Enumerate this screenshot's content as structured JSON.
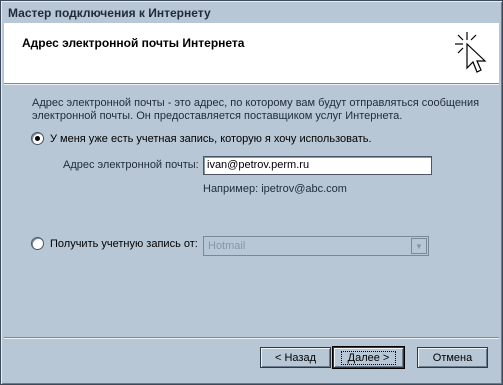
{
  "window": {
    "title": "Мастер подключения к Интернету"
  },
  "header": {
    "title": "Адрес электронной почты Интернета",
    "icon": "sparkle-cursor-icon"
  },
  "body": {
    "description": "Адрес электронной почты - это адрес, по которому вам будут отправляться сообщения электронной почты. Он предоставляется поставщиком услуг Интернета.",
    "option_existing": "У меня уже есть учетная запись, которую я хочу использовать.",
    "email_label": "Адрес электронной почты:",
    "email_value": "ivan@petrov.perm.ru",
    "example": "Например: ipetrov@abc.com",
    "option_new": "Получить учетную запись от:",
    "provider_value": "Hotmail"
  },
  "buttons": {
    "back": "< Назад",
    "next": "Далее >",
    "cancel": "Отмена"
  }
}
